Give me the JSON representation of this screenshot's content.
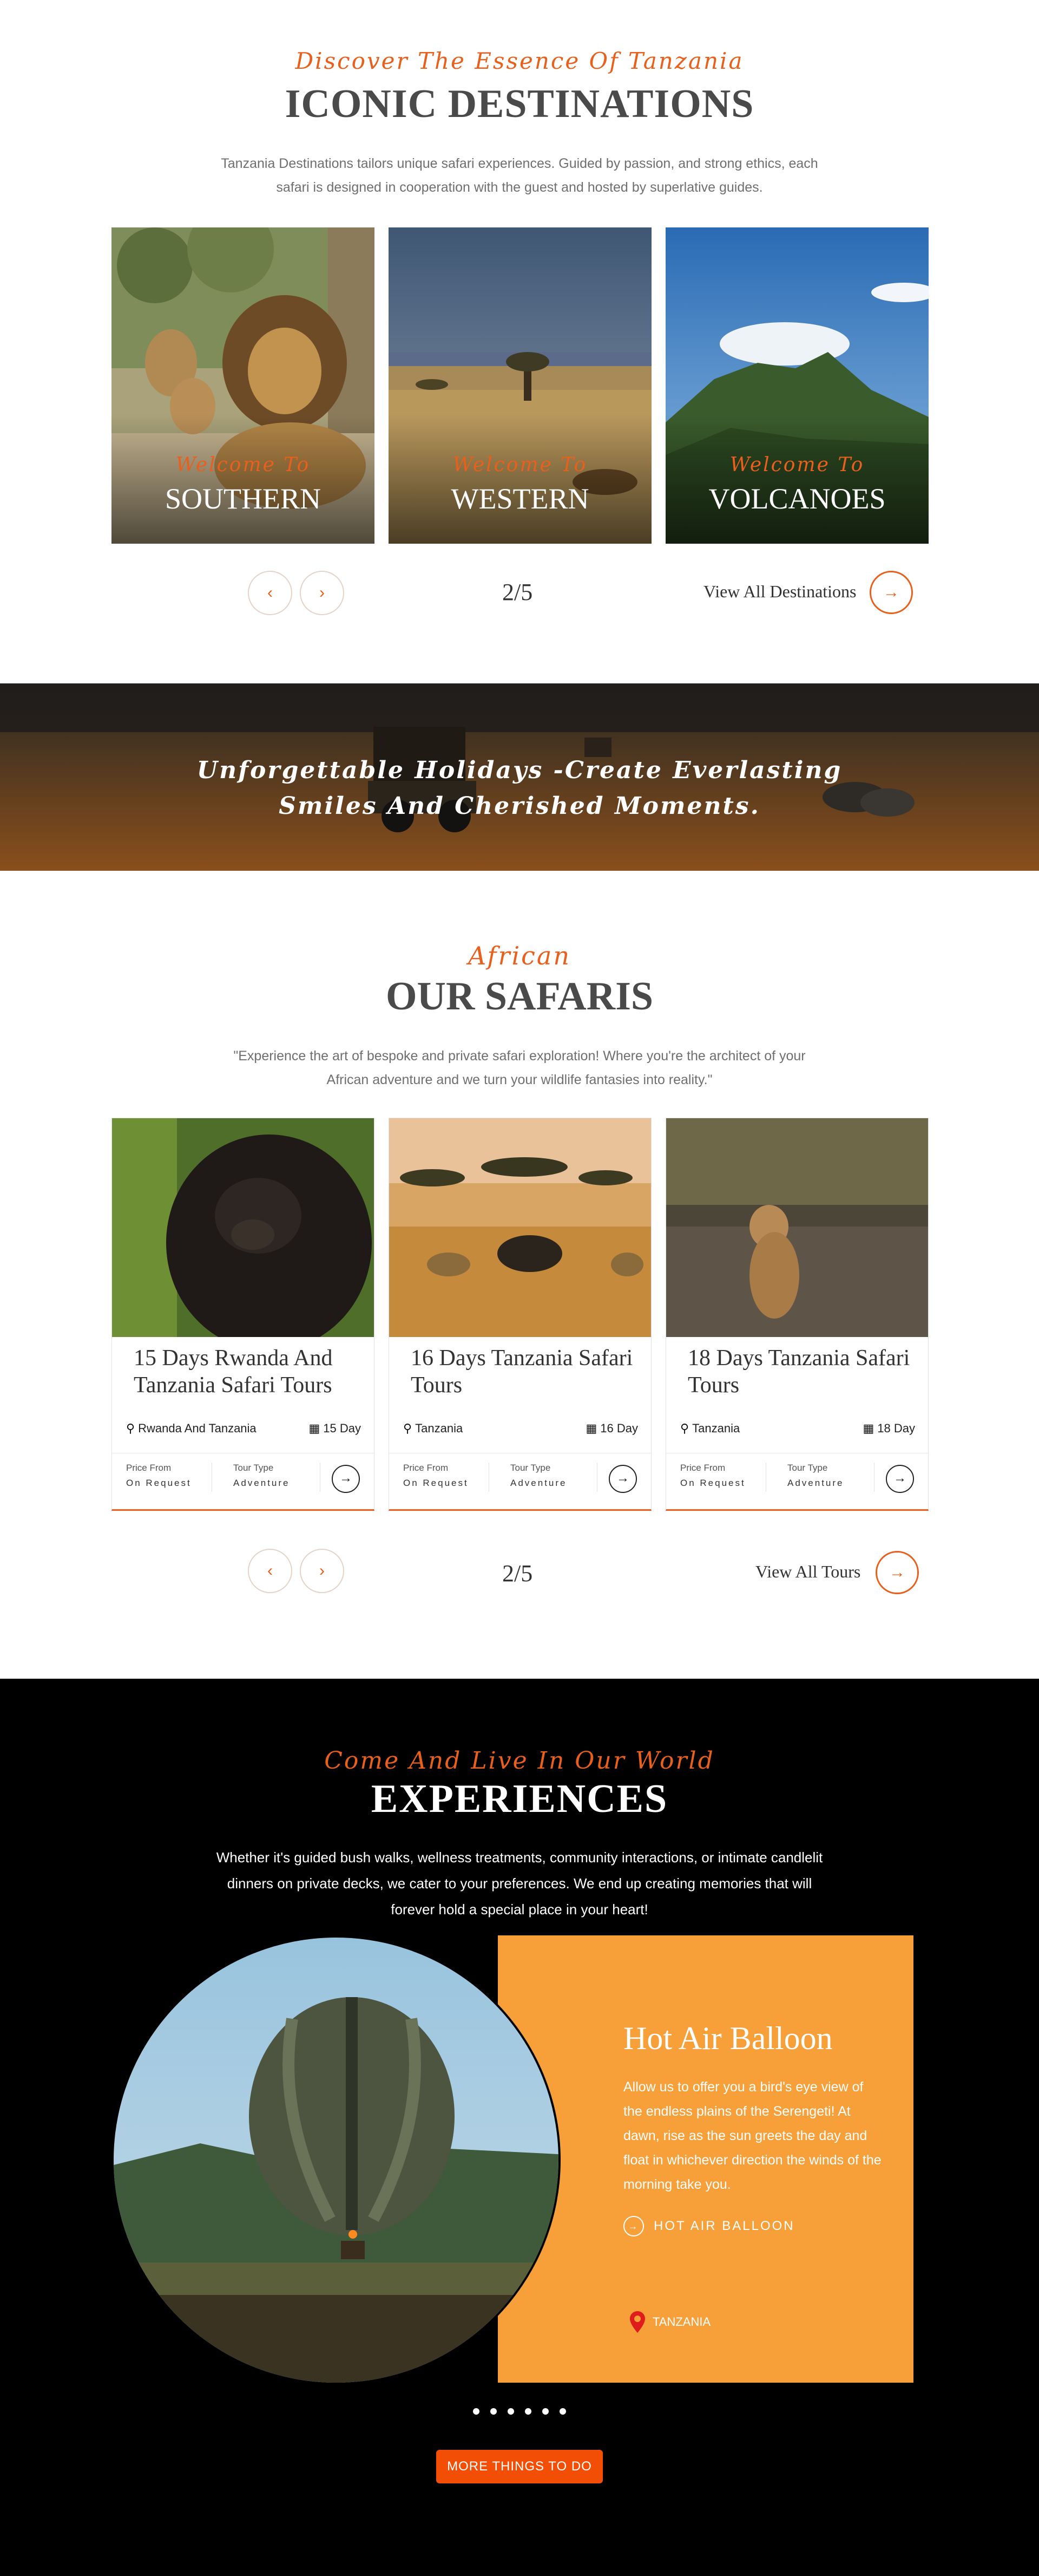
{
  "destinations": {
    "kicker": "Discover The Essence Of Tanzania",
    "heading": "ICONIC DESTINATIONS",
    "intro": "Tanzania Destinations tailors unique safari experiences. Guided by passion, and strong ethics, each safari is designed in cooperation with the guest and hosted by superlative guides.",
    "cards": [
      {
        "welcome": "Welcome To",
        "name": "SOUTHERN"
      },
      {
        "welcome": "Welcome To",
        "name": "WESTERN"
      },
      {
        "welcome": "Welcome To",
        "name": "VOLCANOES"
      }
    ],
    "prev_label": "‹",
    "next_label": "›",
    "pager": "2/5",
    "view_all": "View All Destinations",
    "arrow": "→"
  },
  "banner": {
    "text": "Unforgettable Holidays -Create Everlasting Smiles And Cherished Moments."
  },
  "safaris": {
    "kicker": "African",
    "heading": "OUR SAFARIS",
    "intro": "\"Experience the art of bespoke and private safari exploration! Where you're the architect of your African adventure and we turn your wildlife fantasies into reality.\"",
    "tours": [
      {
        "title": "15 Days Rwanda And Tanzania Safari Tours",
        "location": "Rwanda And Tanzania",
        "days": "15 Day",
        "price_label": "Price From",
        "price": "On Request",
        "type_label": "Tour Type",
        "type": "Adventure"
      },
      {
        "title": "16 Days Tanzania Safari Tours",
        "location": "Tanzania",
        "days": "16 Day",
        "price_label": "Price From",
        "price": "On Request",
        "type_label": "Tour Type",
        "type": "Adventure"
      },
      {
        "title": "18 Days Tanzania Safari Tours",
        "location": "Tanzania",
        "days": "18 Day",
        "price_label": "Price From",
        "price": "On Request",
        "type_label": "Tour Type",
        "type": "Adventure"
      }
    ],
    "prev_label": "‹",
    "next_label": "›",
    "pager": "2/5",
    "view_all": "View All Tours",
    "arrow": "→"
  },
  "experiences": {
    "kicker": "Come And Live In Our World",
    "heading": "EXPERIENCES",
    "intro": "Whether it's guided bush walks, wellness treatments, community interactions, or intimate candlelit dinners on private decks, we cater to your preferences. We end up creating memories that will forever hold a special place in your heart!",
    "title": "Hot Air Balloon",
    "description": "Allow us to offer you a bird's eye view of the endless plains of the Serengeti! At dawn, rise as the sun greets the day and float in whichever direction the winds of the morning take you.",
    "link_label": "HOT AIR BALLOON",
    "location": "TANZANIA",
    "more_button": "MORE THINGS TO DO",
    "arrow": "→"
  },
  "colors": {
    "accent": "#e8601c",
    "panel": "#f7a03a",
    "button": "#f24e06"
  }
}
